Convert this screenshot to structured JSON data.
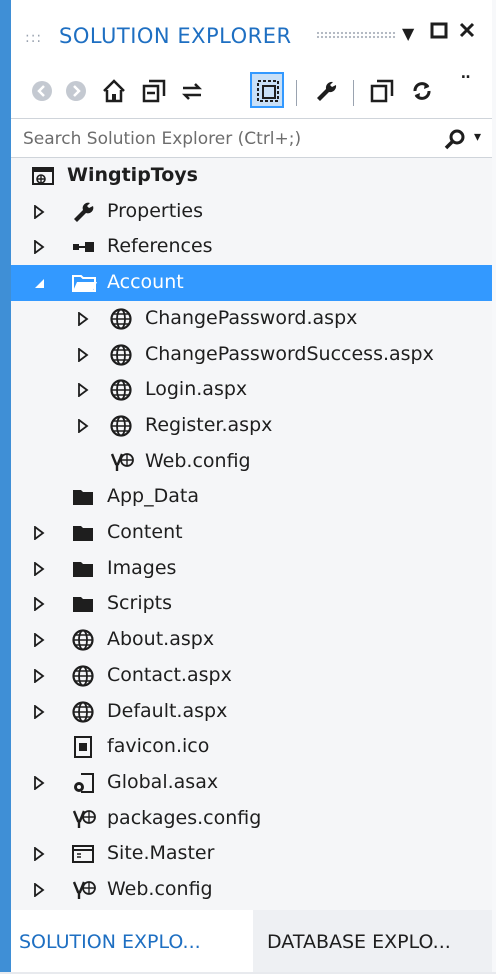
{
  "panel": {
    "title": "SOLUTION EXPLORER",
    "controls": [
      "dropdown-arrow-icon",
      "maximize-icon",
      "close-icon"
    ],
    "accent": "#3399ff",
    "title_color": "#1e6fc2"
  },
  "toolbar": {
    "icons": [
      "back-icon",
      "forward-icon",
      "home-icon",
      "collapse-all-icon",
      "sync-icon",
      "show-all-files-icon",
      "properties-wrench-icon",
      "copy-icon",
      "refresh-icon"
    ]
  },
  "search": {
    "placeholder": "Search Solution Explorer (Ctrl+;)"
  },
  "tree": {
    "items": [
      {
        "label": "WingtipToys",
        "icon": "web-project-icon",
        "expander": "none",
        "depth": 0,
        "bold": true
      },
      {
        "label": "Properties",
        "icon": "wrench-icon",
        "expander": "collapsed",
        "depth": 1
      },
      {
        "label": "References",
        "icon": "references-icon",
        "expander": "collapsed",
        "depth": 1
      },
      {
        "label": "Account",
        "icon": "folder-open-icon",
        "expander": "expanded",
        "depth": 1,
        "selected": true
      },
      {
        "label": "ChangePassword.aspx",
        "icon": "globe-icon",
        "expander": "collapsed",
        "depth": 2
      },
      {
        "label": "ChangePasswordSuccess.aspx",
        "icon": "globe-icon",
        "expander": "collapsed",
        "depth": 2
      },
      {
        "label": "Login.aspx",
        "icon": "globe-icon",
        "expander": "collapsed",
        "depth": 2
      },
      {
        "label": "Register.aspx",
        "icon": "globe-icon",
        "expander": "collapsed",
        "depth": 2
      },
      {
        "label": "Web.config",
        "icon": "config-icon",
        "expander": "none",
        "depth": 2
      },
      {
        "label": "App_Data",
        "icon": "folder-icon",
        "expander": "none",
        "depth": 1
      },
      {
        "label": "Content",
        "icon": "folder-icon",
        "expander": "collapsed",
        "depth": 1
      },
      {
        "label": "Images",
        "icon": "folder-icon",
        "expander": "collapsed",
        "depth": 1
      },
      {
        "label": "Scripts",
        "icon": "folder-icon",
        "expander": "collapsed",
        "depth": 1
      },
      {
        "label": "About.aspx",
        "icon": "globe-icon",
        "expander": "collapsed",
        "depth": 1
      },
      {
        "label": "Contact.aspx",
        "icon": "globe-icon",
        "expander": "collapsed",
        "depth": 1
      },
      {
        "label": "Default.aspx",
        "icon": "globe-icon",
        "expander": "collapsed",
        "depth": 1
      },
      {
        "label": "favicon.ico",
        "icon": "image-file-icon",
        "expander": "none",
        "depth": 1
      },
      {
        "label": "Global.asax",
        "icon": "global-asax-icon",
        "expander": "collapsed",
        "depth": 1
      },
      {
        "label": "packages.config",
        "icon": "config-icon",
        "expander": "none",
        "depth": 1
      },
      {
        "label": "Site.Master",
        "icon": "master-page-icon",
        "expander": "collapsed",
        "depth": 1
      },
      {
        "label": "Web.config",
        "icon": "config-icon",
        "expander": "collapsed",
        "depth": 1
      }
    ]
  },
  "tabs": [
    {
      "label": "SOLUTION EXPLO...",
      "active": true
    },
    {
      "label": "DATABASE EXPLO...",
      "active": false
    }
  ]
}
